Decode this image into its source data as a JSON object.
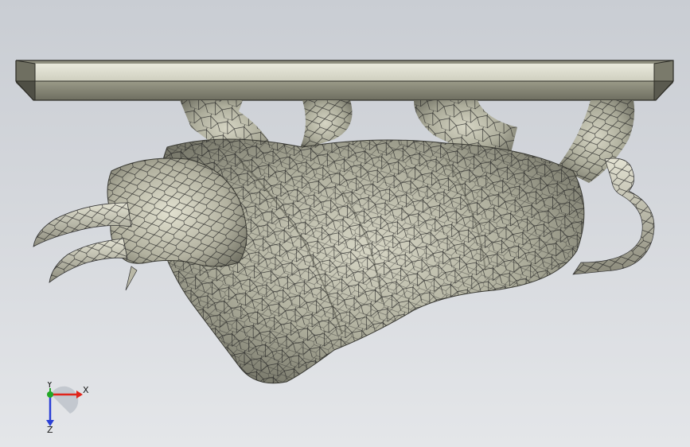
{
  "viewport": {
    "background_top": "#c9cdd3",
    "background_bottom": "#e4e6e9",
    "model_color": "#b9b8a6",
    "mesh_color": "#222222"
  },
  "triad": {
    "x_label": "X",
    "y_label": "Y",
    "z_label": "Z",
    "x_color": "#e0241a",
    "y_color": "#22a826",
    "z_color": "#2a3fd6"
  }
}
